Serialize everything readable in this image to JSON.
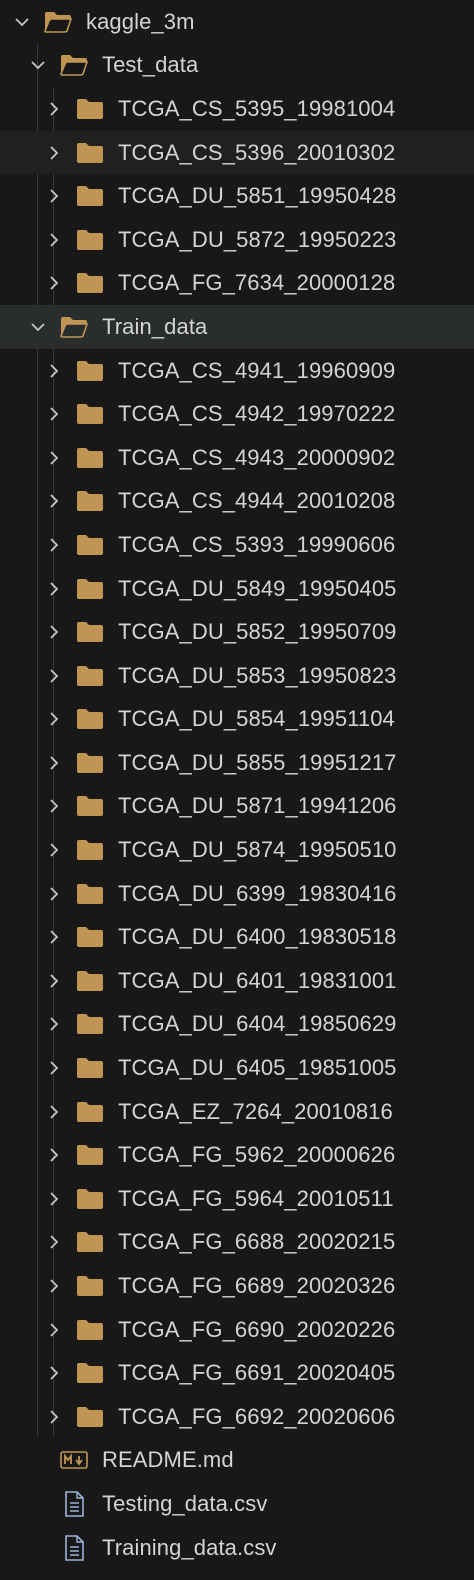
{
  "root": {
    "label": "kaggle_3m",
    "expanded": true,
    "icon": "folder-open-icon"
  },
  "test_folder": {
    "label": "Test_data",
    "expanded": true,
    "icon": "folder-open-icon",
    "items": [
      "TCGA_CS_5395_19981004",
      "TCGA_CS_5396_20010302",
      "TCGA_DU_5851_19950428",
      "TCGA_DU_5872_19950223",
      "TCGA_FG_7634_20000128"
    ]
  },
  "train_folder": {
    "label": "Train_data",
    "expanded": true,
    "icon": "folder-open-icon",
    "items": [
      "TCGA_CS_4941_19960909",
      "TCGA_CS_4942_19970222",
      "TCGA_CS_4943_20000902",
      "TCGA_CS_4944_20010208",
      "TCGA_CS_5393_19990606",
      "TCGA_DU_5849_19950405",
      "TCGA_DU_5852_19950709",
      "TCGA_DU_5853_19950823",
      "TCGA_DU_5854_19951104",
      "TCGA_DU_5855_19951217",
      "TCGA_DU_5871_19941206",
      "TCGA_DU_5874_19950510",
      "TCGA_DU_6399_19830416",
      "TCGA_DU_6400_19830518",
      "TCGA_DU_6401_19831001",
      "TCGA_DU_6404_19850629",
      "TCGA_DU_6405_19851005",
      "TCGA_EZ_7264_20010816",
      "TCGA_FG_5962_20000626",
      "TCGA_FG_5964_20010511",
      "TCGA_FG_6688_20020215",
      "TCGA_FG_6689_20020326",
      "TCGA_FG_6690_20020226",
      "TCGA_FG_6691_20020405",
      "TCGA_FG_6692_20020606"
    ]
  },
  "files": [
    {
      "label": "README.md",
      "icon": "markdown-icon"
    },
    {
      "label": "Testing_data.csv",
      "icon": "file-lines-icon"
    },
    {
      "label": "Training_data.csv",
      "icon": "file-lines-icon"
    }
  ],
  "colors": {
    "background": "#181818",
    "folder": "#c09553",
    "text": "#d4d4d4",
    "chevron": "#c5c5c5",
    "selection": "#2a2d2e",
    "hover": "#202020"
  }
}
